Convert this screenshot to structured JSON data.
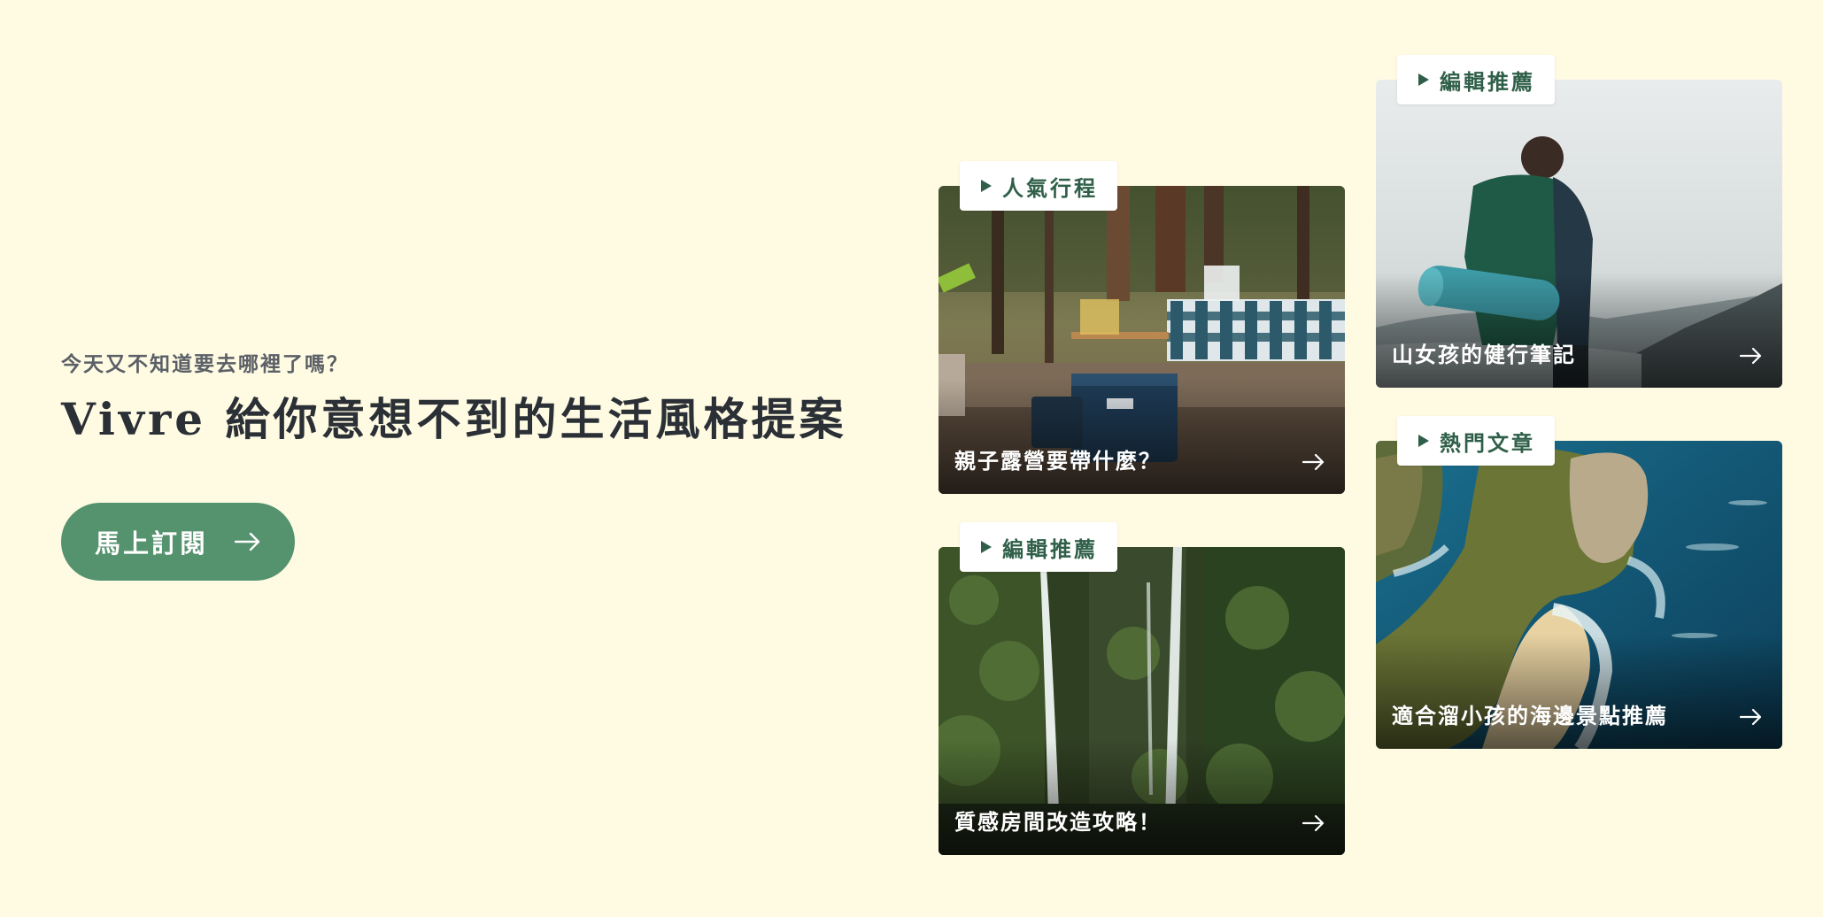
{
  "hero": {
    "subtitle": "今天又不知道要去哪裡了嗎？",
    "title": "Vivre 給你意想不到的生活風格提案",
    "cta_label": "馬上訂閱"
  },
  "cards": {
    "camping": {
      "tag": "人氣行程",
      "caption": "親子露營要帶什麼？",
      "image": "campsite-photo"
    },
    "waterfall": {
      "tag": "編輯推薦",
      "caption": "質感房間改造攻略！",
      "image": "waterfall-photo"
    },
    "hiker": {
      "tag": "編輯推薦",
      "caption": "山女孩的健行筆記",
      "image": "hiker-photo"
    },
    "beach": {
      "tag": "熱門文章",
      "caption": "適合溜小孩的海邊景點推薦",
      "image": "coastal-cliff-photo"
    }
  },
  "icons": {
    "arrow": "arrow-right-icon",
    "tag_marker": "play-triangle-icon"
  },
  "colors": {
    "background": "#fffbe3",
    "accent": "#55926e",
    "tag_text": "#2f5f49",
    "title_text": "#2b3036"
  }
}
